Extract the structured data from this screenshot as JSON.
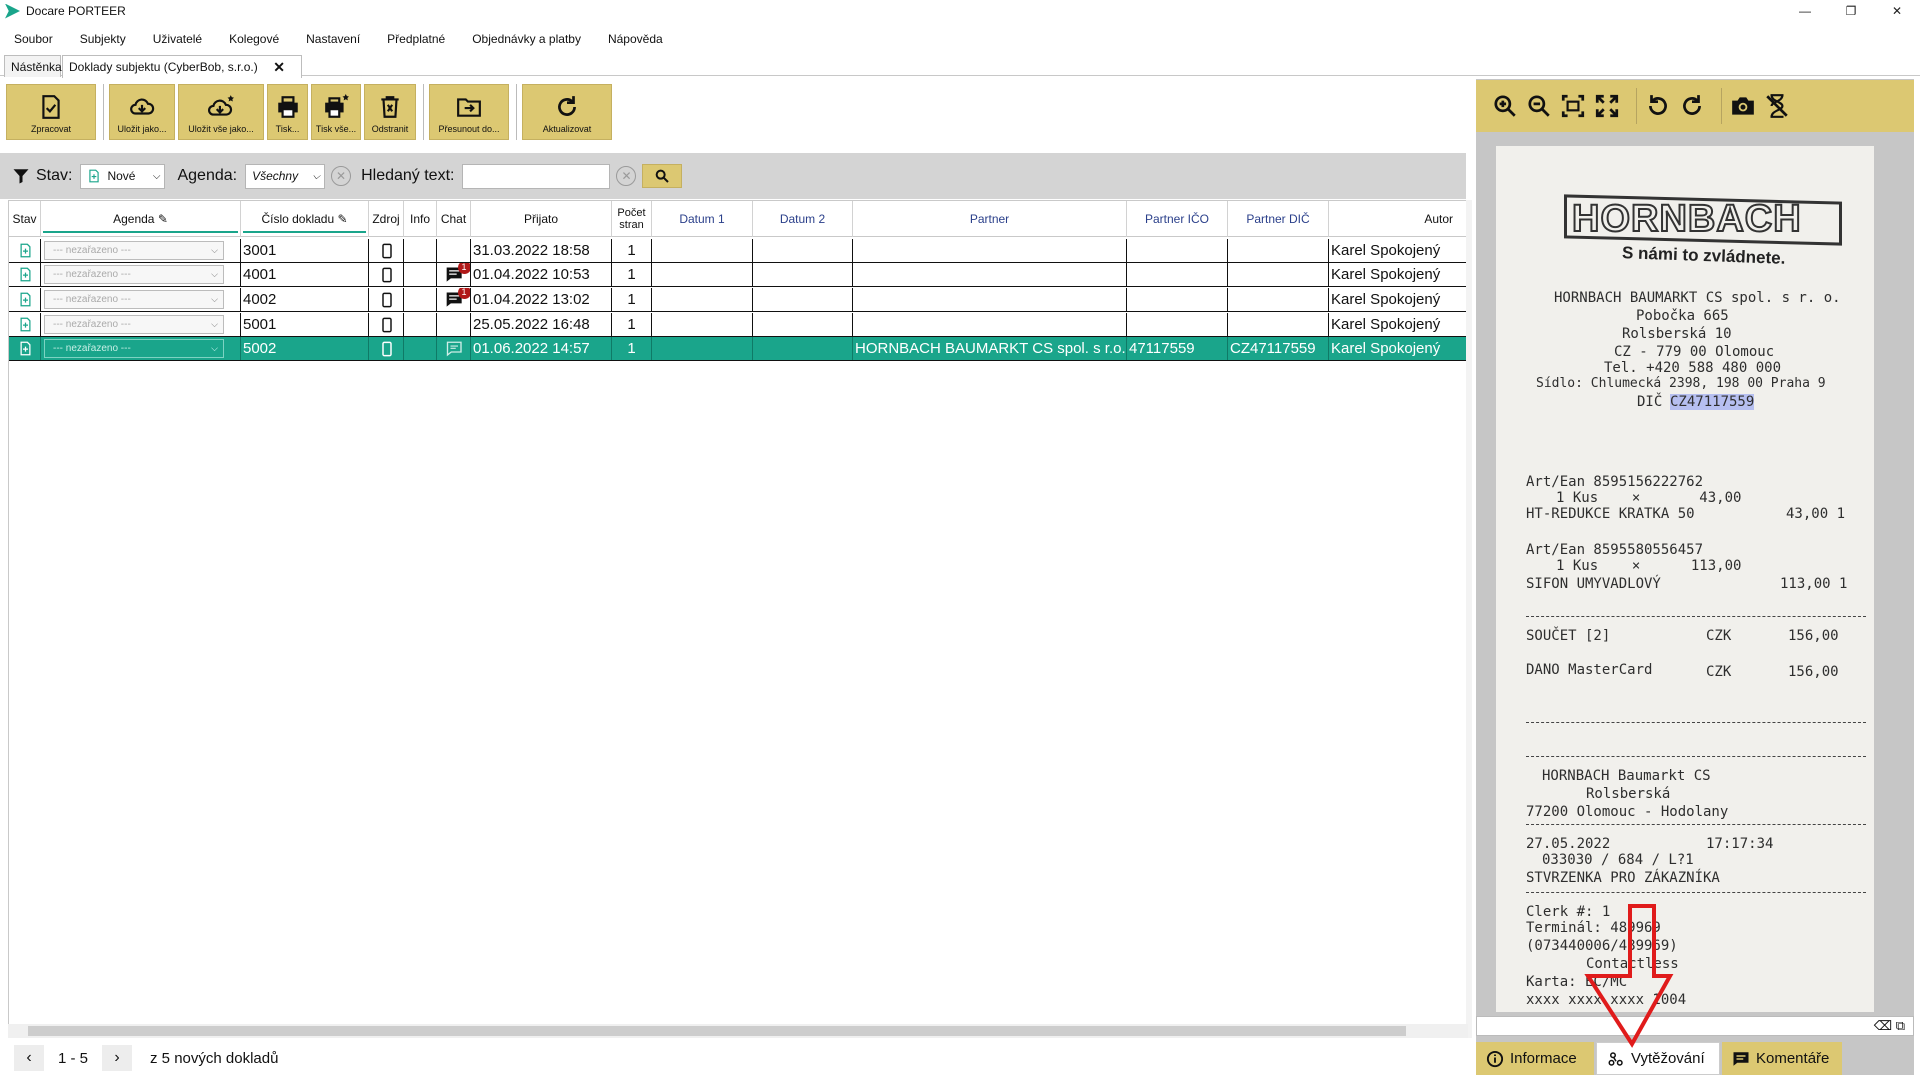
{
  "window": {
    "title": "Docare PORTEER",
    "minimize": "—",
    "maximize": "❐",
    "close": "✕"
  },
  "menu": [
    "Soubor",
    "Subjekty",
    "Uživatelé",
    "Kolegové",
    "Nastavení",
    "Předplatné",
    "Objednávky a platby",
    "Nápověda"
  ],
  "tabs": [
    {
      "label": "Nástěnka"
    },
    {
      "label": "Doklady subjektu (CyberBob, s.r.o.)",
      "close": "✕"
    }
  ],
  "toolbar": {
    "process": "Zpracovat",
    "save_as": "Uložit jako...",
    "save_all_as": "Uložit vše jako...",
    "print": "Tisk...",
    "print_all": "Tisk vše...",
    "delete": "Odstranit",
    "move_to": "Přesunout do...",
    "refresh": "Aktualizovat"
  },
  "filter": {
    "status_label": "Stav:",
    "status_value": "Nové",
    "agenda_label": "Agenda:",
    "agenda_value": "Všechny",
    "search_label": "Hledaný text:",
    "search_value": "",
    "clear": "✕"
  },
  "table": {
    "headers": {
      "stav": "Stav",
      "agenda": "Agenda",
      "cislo": "Číslo dokladu",
      "zdroj": "Zdroj",
      "info": "Info",
      "chat": "Chat",
      "prijato": "Přijato",
      "pocet": "Počet stran",
      "datum1": "Datum 1",
      "datum2": "Datum 2",
      "partner": "Partner",
      "ico": "Partner IČO",
      "dic": "Partner DIČ",
      "autor": "Autor"
    },
    "agenda_placeholder": "--- nezařazeno ---",
    "rows": [
      {
        "cislo": "3001",
        "prijato": "31.03.2022 18:58",
        "pocet": "1",
        "partner": "",
        "ico": "",
        "dic": "",
        "autor": "Karel Spokojený",
        "chat": ""
      },
      {
        "cislo": "4001",
        "prijato": "01.04.2022 10:53",
        "pocet": "1",
        "partner": "",
        "ico": "",
        "dic": "",
        "autor": "Karel Spokojený",
        "chat": "1"
      },
      {
        "cislo": "4002",
        "prijato": "01.04.2022 13:02",
        "pocet": "1",
        "partner": "",
        "ico": "",
        "dic": "",
        "autor": "Karel Spokojený",
        "chat": "1"
      },
      {
        "cislo": "5001",
        "prijato": "25.05.2022 16:48",
        "pocet": "1",
        "partner": "",
        "ico": "",
        "dic": "",
        "autor": "Karel Spokojený",
        "chat": ""
      },
      {
        "cislo": "5002",
        "prijato": "01.06.2022 14:57",
        "pocet": "1",
        "partner": "HORNBACH BAUMARKT CS spol. s r.o.",
        "ico": "47117559",
        "dic": "CZ47117559",
        "autor": "Karel Spokojený",
        "chat": ""
      }
    ]
  },
  "pager": {
    "range": "1 - 5",
    "summary": "z 5 nových dokladů",
    "prev": "‹",
    "next": "›"
  },
  "receipt": {
    "brand": "HORNBACH",
    "slogan": "S námi to zvládnete.",
    "lines": [
      "HORNBACH BAUMARKT CS spol. s r. o.",
      "Pobočka 665",
      "Rolsberská 10",
      "CZ - 779 00 Olomouc",
      "Tel. +420 588 480 000",
      "Sídlo: Chlumecká 2398, 198 00 Praha 9",
      "DIČ",
      "CZ47117559",
      "Art/Ean 8595156222762",
      "1 Kus    ×       43,00",
      "HT-REDUKCE KRATKA 50",
      "43,00 1",
      "Art/Ean 8595580556457",
      "1 Kus    ×      113,00",
      "SIFON UMYVADLOVÝ",
      "113,00 1",
      "SOUČET [2]",
      "CZK",
      "156,00",
      "DANO MasterCard",
      "CZK",
      "156,00",
      "HORNBACH Baumarkt CS",
      "Rolsberská",
      "77200 Olomouc - Hodolany",
      "27.05.2022",
      "17:17:34",
      "033030 / 684 / L?1",
      "STVRZENKA PRO ZÁKAZNÍKA",
      "Clerk #: 1",
      "Terminál: 489969",
      "(073440006/489969)",
      "Contactless",
      "Karta: EC/MC",
      "xxxx xxxx xxxx 1004"
    ]
  },
  "rtabs": {
    "info": "Informace",
    "extract": "Vytěžování",
    "comments": "Komentáře"
  },
  "colors": {
    "accent": "#1aa58b",
    "toolbar": "#dcc872",
    "selected_row": "#1aa58b",
    "arrow": "#e01b1b"
  }
}
